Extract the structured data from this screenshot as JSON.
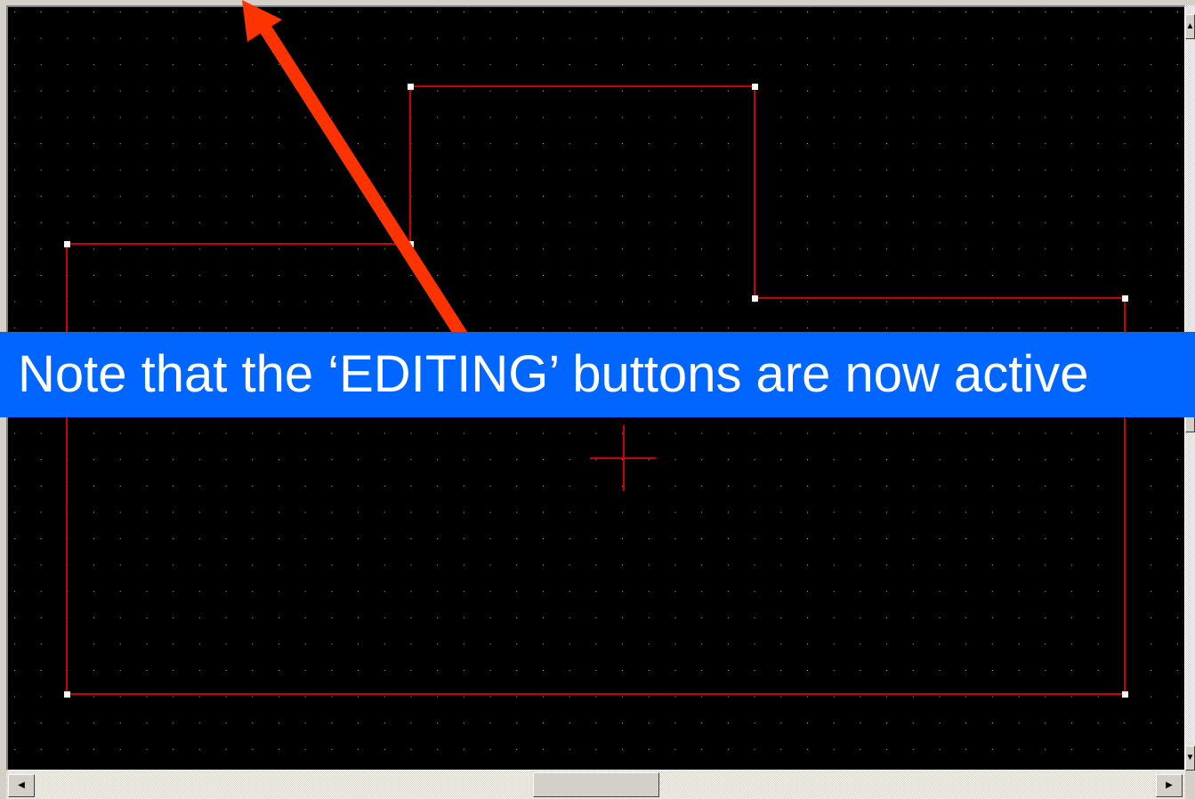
{
  "caption": {
    "text": "Note that the ‘EDITING’ buttons are now active"
  },
  "canvas": {
    "background_color": "#000000",
    "grid_dot_color": "#c0c0c0",
    "shape_color": "#cc0000",
    "vertex_handle_color": "#ffffff",
    "cursor_color": "#cc0000"
  },
  "annotation": {
    "arrow_color": "#ff3300",
    "banner_color": "#0066ff"
  },
  "scrollbars": {
    "up_icon": "▲",
    "down_icon": "▼",
    "left_icon": "◀",
    "right_icon": "▶"
  }
}
